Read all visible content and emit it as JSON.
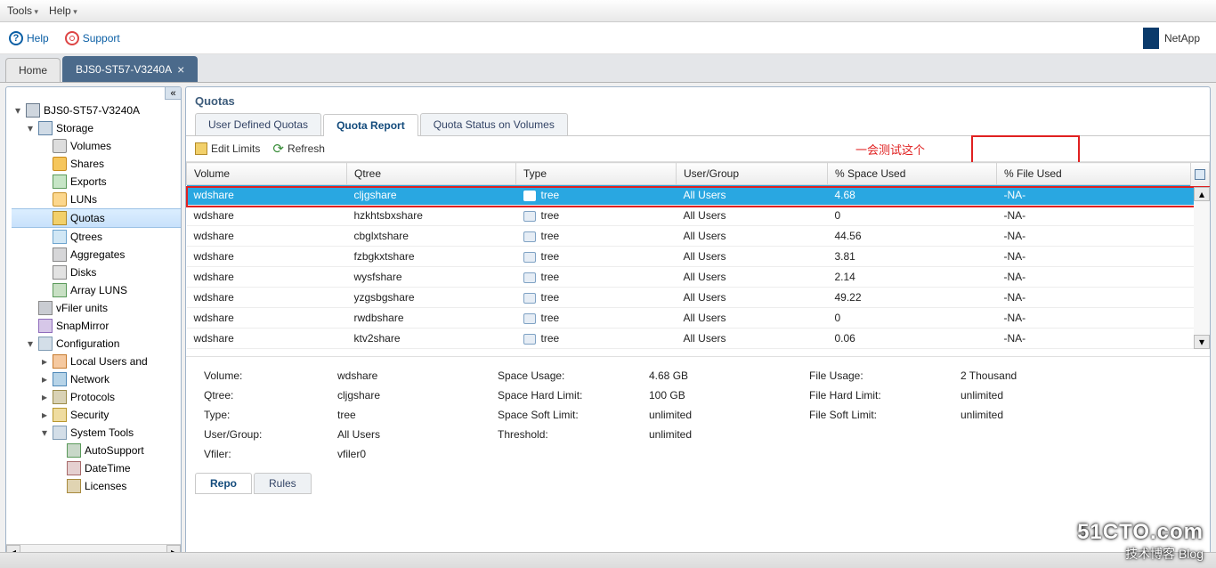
{
  "menubar": {
    "tools": "Tools",
    "help": "Help"
  },
  "toolbar": {
    "help": "Help",
    "support": "Support"
  },
  "brand": "NetApp",
  "main_tabs": {
    "home": "Home",
    "active": "BJS0-ST57-V3240A"
  },
  "tree": {
    "node": "BJS0-ST57-V3240A",
    "storage": "Storage",
    "volumes": "Volumes",
    "shares": "Shares",
    "exports": "Exports",
    "luns": "LUNs",
    "quotas": "Quotas",
    "qtrees": "Qtrees",
    "aggregates": "Aggregates",
    "disks": "Disks",
    "array_luns": "Array LUNS",
    "vfiler": "vFiler units",
    "snapmirror": "SnapMirror",
    "config": "Configuration",
    "local_users": "Local Users and",
    "network": "Network",
    "protocols": "Protocols",
    "security": "Security",
    "system_tools": "System Tools",
    "autosupport": "AutoSupport",
    "datetime": "DateTime",
    "licenses": "Licenses"
  },
  "panel": {
    "title": "Quotas",
    "tabs": {
      "udq": "User Defined Quotas",
      "qr": "Quota Report",
      "qsv": "Quota Status on Volumes"
    },
    "tb": {
      "edit": "Edit Limits",
      "refresh": "Refresh"
    },
    "annotation": "一会测试这个"
  },
  "grid": {
    "headers": {
      "volume": "Volume",
      "qtree": "Qtree",
      "type": "Type",
      "ug": "User/Group",
      "space": "% Space Used",
      "file": "% File Used"
    },
    "rows": [
      {
        "volume": "wdshare",
        "qtree": "cljgshare",
        "type": "tree",
        "ug": "All Users",
        "space": "4.68",
        "file": "-NA-"
      },
      {
        "volume": "wdshare",
        "qtree": "hzkhtsbxshare",
        "type": "tree",
        "ug": "All Users",
        "space": "0",
        "file": "-NA-"
      },
      {
        "volume": "wdshare",
        "qtree": "cbglxtshare",
        "type": "tree",
        "ug": "All Users",
        "space": "44.56",
        "file": "-NA-"
      },
      {
        "volume": "wdshare",
        "qtree": "fzbgkxtshare",
        "type": "tree",
        "ug": "All Users",
        "space": "3.81",
        "file": "-NA-"
      },
      {
        "volume": "wdshare",
        "qtree": "wysfshare",
        "type": "tree",
        "ug": "All Users",
        "space": "2.14",
        "file": "-NA-"
      },
      {
        "volume": "wdshare",
        "qtree": "yzgsbgshare",
        "type": "tree",
        "ug": "All Users",
        "space": "49.22",
        "file": "-NA-"
      },
      {
        "volume": "wdshare",
        "qtree": "rwdbshare",
        "type": "tree",
        "ug": "All Users",
        "space": "0",
        "file": "-NA-"
      },
      {
        "volume": "wdshare",
        "qtree": "ktv2share",
        "type": "tree",
        "ug": "All Users",
        "space": "0.06",
        "file": "-NA-"
      }
    ]
  },
  "details": {
    "labels": {
      "volume": "Volume:",
      "qtree": "Qtree:",
      "type": "Type:",
      "ug": "User/Group:",
      "vfiler": "Vfiler:",
      "su": "Space Usage:",
      "shl": "Space Hard Limit:",
      "ssl": "Space Soft Limit:",
      "thr": "Threshold:",
      "fu": "File Usage:",
      "fhl": "File Hard Limit:",
      "fsl": "File Soft Limit:"
    },
    "values": {
      "volume": "wdshare",
      "qtree": "cljgshare",
      "type": "tree",
      "ug": "All Users",
      "vfiler": "vfiler0",
      "su": "4.68 GB",
      "shl": "100 GB",
      "ssl": "unlimited",
      "thr": "unlimited",
      "fu": "2 Thousand",
      "fhl": "unlimited",
      "fsl": "unlimited"
    }
  },
  "bottom_tabs": {
    "repo": "Repo",
    "rules": "Rules"
  },
  "watermark": {
    "l1": "51CTO.com",
    "l2": "技术博客  Blog"
  }
}
